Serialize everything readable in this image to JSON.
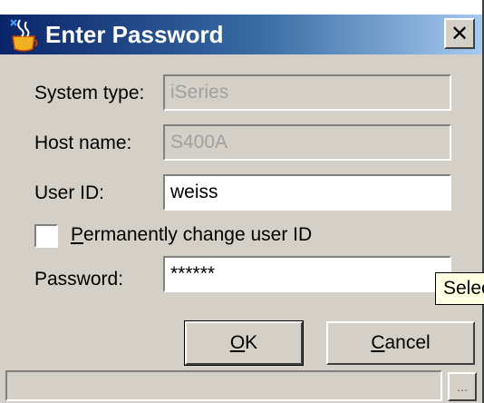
{
  "window": {
    "title": "Enter Password"
  },
  "fields": {
    "system_type": {
      "label": "System type:",
      "value": "iSeries"
    },
    "host_name": {
      "label": "Host name:",
      "value": "S400A"
    },
    "user_id": {
      "label": "User ID:",
      "value": "weiss"
    },
    "password": {
      "label": "Password:",
      "value": "******"
    }
  },
  "checkbox": {
    "prefix": "P",
    "rest": "ermanently change user ID",
    "checked": false
  },
  "tooltip": {
    "text": "Select"
  },
  "buttons": {
    "ok": {
      "mnemonic": "O",
      "rest": "K"
    },
    "cancel": {
      "mnemonic": "C",
      "rest": "ancel"
    },
    "more": "..."
  },
  "icons": {
    "app": "java-cup-icon",
    "close": "close-icon"
  },
  "colors": {
    "title_start": "#0a246a",
    "title_end": "#a6caf0",
    "face": "#d4d0c8"
  }
}
